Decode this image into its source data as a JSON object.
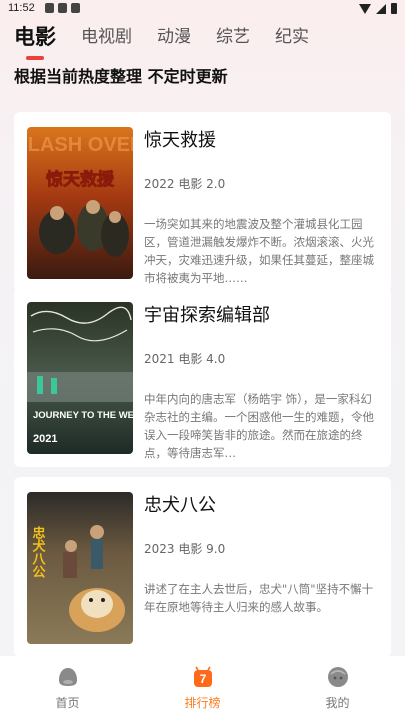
{
  "status": {
    "time": "11:52"
  },
  "tabs": [
    {
      "label": "电影"
    },
    {
      "label": "电视剧"
    },
    {
      "label": "动漫"
    },
    {
      "label": "综艺"
    },
    {
      "label": "纪实"
    }
  ],
  "subtitle": "根据当前热度整理  不定时更新",
  "movies": [
    {
      "title": "惊天救援",
      "meta": "2022 电影 2.0",
      "desc": "一场突如其来的地震波及整个灌城县化工园区，管道泄漏触发爆炸不断。浓烟滚滚、火光冲天，灾难迅速升级，如果任其蔓延，整座城市将被夷为平地……",
      "poster_text": "惊天救援",
      "poster_top_text": "FLASH OVER"
    },
    {
      "title": "宇宙探索编辑部",
      "meta": "2021 电影 4.0",
      "desc": "中年内向的唐志军（杨皓宇 饰），是一家科幻杂志社的主编。一个困惑他一生的难题，令他误入一段啼笑皆非的旅途。然而在旅途的终点，等待唐志军…",
      "poster_text": "JOURNEY TO THE WEST",
      "poster_year": "2021"
    },
    {
      "title": "忠犬八公",
      "meta": "2023 电影 9.0",
      "desc": "讲述了在主人去世后，忠犬\"八筒\"坚持不懈十年在原地等待主人归来的感人故事。",
      "poster_text": "忠犬八公"
    }
  ],
  "nav": [
    {
      "label": "首页"
    },
    {
      "label": "排行榜",
      "badge": "7"
    },
    {
      "label": "我的"
    }
  ],
  "colors": {
    "accent": "#e8433a",
    "nav_active": "#ff7a1a"
  }
}
